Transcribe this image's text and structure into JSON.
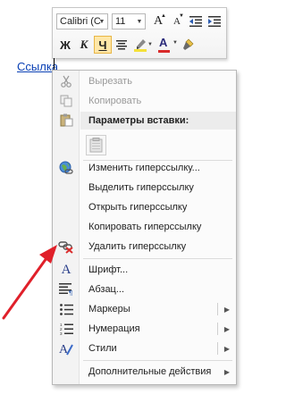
{
  "mini_toolbar": {
    "font_name": "Calibri (С",
    "font_size": "11",
    "grow_font": "A",
    "shrink_font": "A",
    "bold": "Ж",
    "italic": "К",
    "underline": "Ч",
    "font_color_letter": "A",
    "accent_highlight": "#f4e13a",
    "accent_fontcolor": "#d92b2b",
    "active_button": "underline"
  },
  "document": {
    "link_text": "Ссылка"
  },
  "context_menu": {
    "cut": "Вырезать",
    "copy": "Копировать",
    "paste_options": "Параметры вставки:",
    "edit_link": "Изменить гиперссылку...",
    "select_link": "Выделить гиперссылку",
    "open_link": "Открыть гиперссылку",
    "copy_link": "Копировать гиперссылку",
    "remove_link": "Удалить гиперссылку",
    "font": "Шрифт...",
    "paragraph": "Абзац...",
    "bullets": "Маркеры",
    "numbering": "Нумерация",
    "styles": "Стили",
    "more_actions": "Дополнительные действия"
  },
  "annotation": {
    "arrow_color": "#e0202a"
  }
}
